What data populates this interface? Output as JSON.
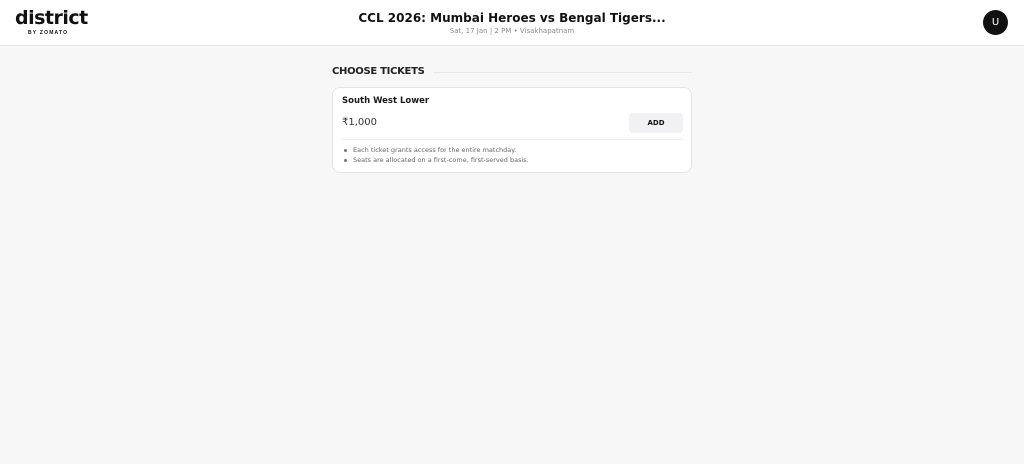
{
  "header": {
    "logo_text": "district",
    "logo_subtext": "BY ZOMATO",
    "event_title": "CCL 2026: Mumbai Heroes vs Bengal Tigers...",
    "event_meta": "Sat, 17 Jan | 2 PM • Visakhapatnam",
    "avatar_initial": "U"
  },
  "tickets_section": {
    "title": "CHOOSE TICKETS",
    "tickets": [
      {
        "name": "South West Lower",
        "price": "₹1,000",
        "add_label": "ADD",
        "notes": [
          "Each ticket grants access for the entire matchday.",
          "Seats are allocated on a first-come, first-served basis."
        ]
      }
    ]
  },
  "colors": {
    "background": "#f7f7f7",
    "card": "#ffffff",
    "text_primary": "#111111",
    "text_muted": "#8a8a8a",
    "button_bg": "#f1f1f3",
    "avatar_bg": "#111111"
  }
}
